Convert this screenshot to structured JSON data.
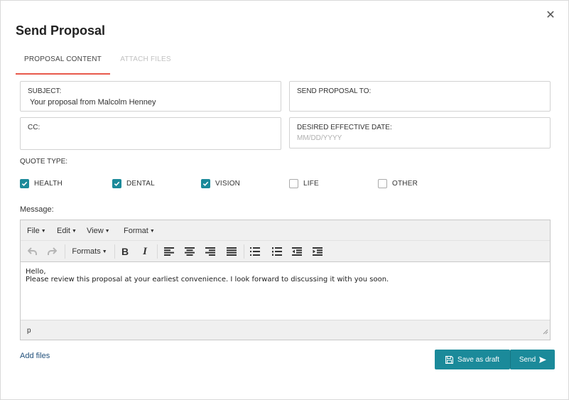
{
  "modal": {
    "title": "Send Proposal",
    "close_icon": "close-icon"
  },
  "tabs": [
    {
      "label": "PROPOSAL CONTENT",
      "active": true
    },
    {
      "label": "ATTACH FILES",
      "active": false
    }
  ],
  "fields": {
    "subject": {
      "label": "SUBJECT:",
      "value": "Your proposal from Malcolm Henney"
    },
    "send_to": {
      "label": "SEND PROPOSAL TO:",
      "value": ""
    },
    "cc": {
      "label": "CC:",
      "value": ""
    },
    "effective_date": {
      "label": "DESIRED EFFECTIVE DATE:",
      "placeholder": "MM/DD/YYYY"
    }
  },
  "quote_type": {
    "label": "QUOTE TYPE:",
    "options": [
      {
        "label": "HEALTH",
        "checked": true
      },
      {
        "label": "DENTAL",
        "checked": true
      },
      {
        "label": "VISION",
        "checked": true
      },
      {
        "label": "LIFE",
        "checked": false
      },
      {
        "label": "OTHER",
        "checked": false
      }
    ]
  },
  "message": {
    "label": "Message:",
    "menus": [
      "File",
      "Edit",
      "View",
      "Format"
    ],
    "formats_label": "Formats",
    "toolbar_icons": [
      "undo-icon",
      "redo-icon",
      "bold-icon",
      "italic-icon",
      "align-left-icon",
      "align-center-icon",
      "align-right-icon",
      "align-justify-icon",
      "bullet-list-icon",
      "numbered-list-icon",
      "outdent-icon",
      "indent-icon"
    ],
    "body_lines": [
      "Hello,",
      "Please review this proposal at your earliest convenience. I look forward to discussing it with you soon."
    ],
    "status_path": "p"
  },
  "footer": {
    "add_files": "Add files",
    "save_draft": "Save as draft",
    "send": "Send"
  },
  "colors": {
    "accent": "#1b8a9a",
    "tab_underline": "#e8594c",
    "link": "#1f4e79"
  }
}
